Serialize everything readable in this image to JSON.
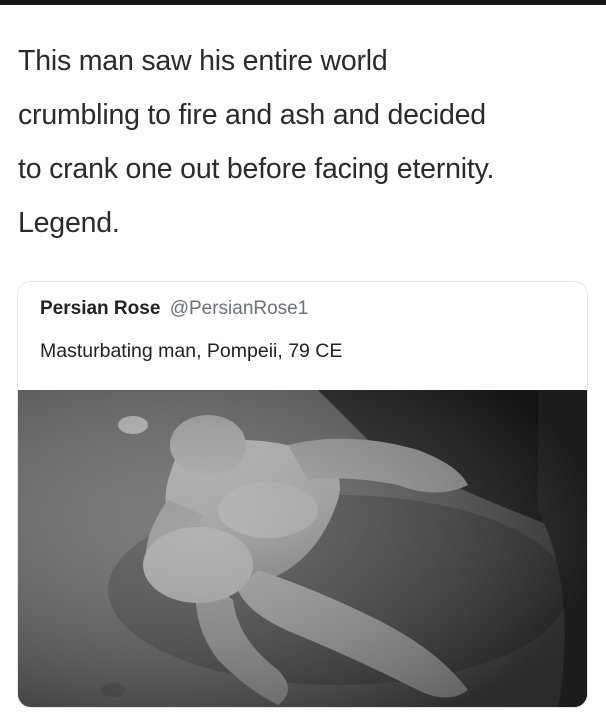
{
  "post": {
    "caption_lines": [
      "This man saw his entire world",
      "crumbling to fire and ash and decided",
      "to crank one out before facing eternity.",
      "Legend."
    ]
  },
  "quoted_tweet": {
    "display_name": "Persian Rose",
    "handle": "@PersianRose1",
    "text": "Masturbating man, Pompeii, 79 CE",
    "photo_icon": "plaster-cast-photo"
  },
  "colors": {
    "text": "#2b2b2b",
    "handle": "#6b7278",
    "border": "#e1e6ea",
    "top_bar": "#141414"
  }
}
